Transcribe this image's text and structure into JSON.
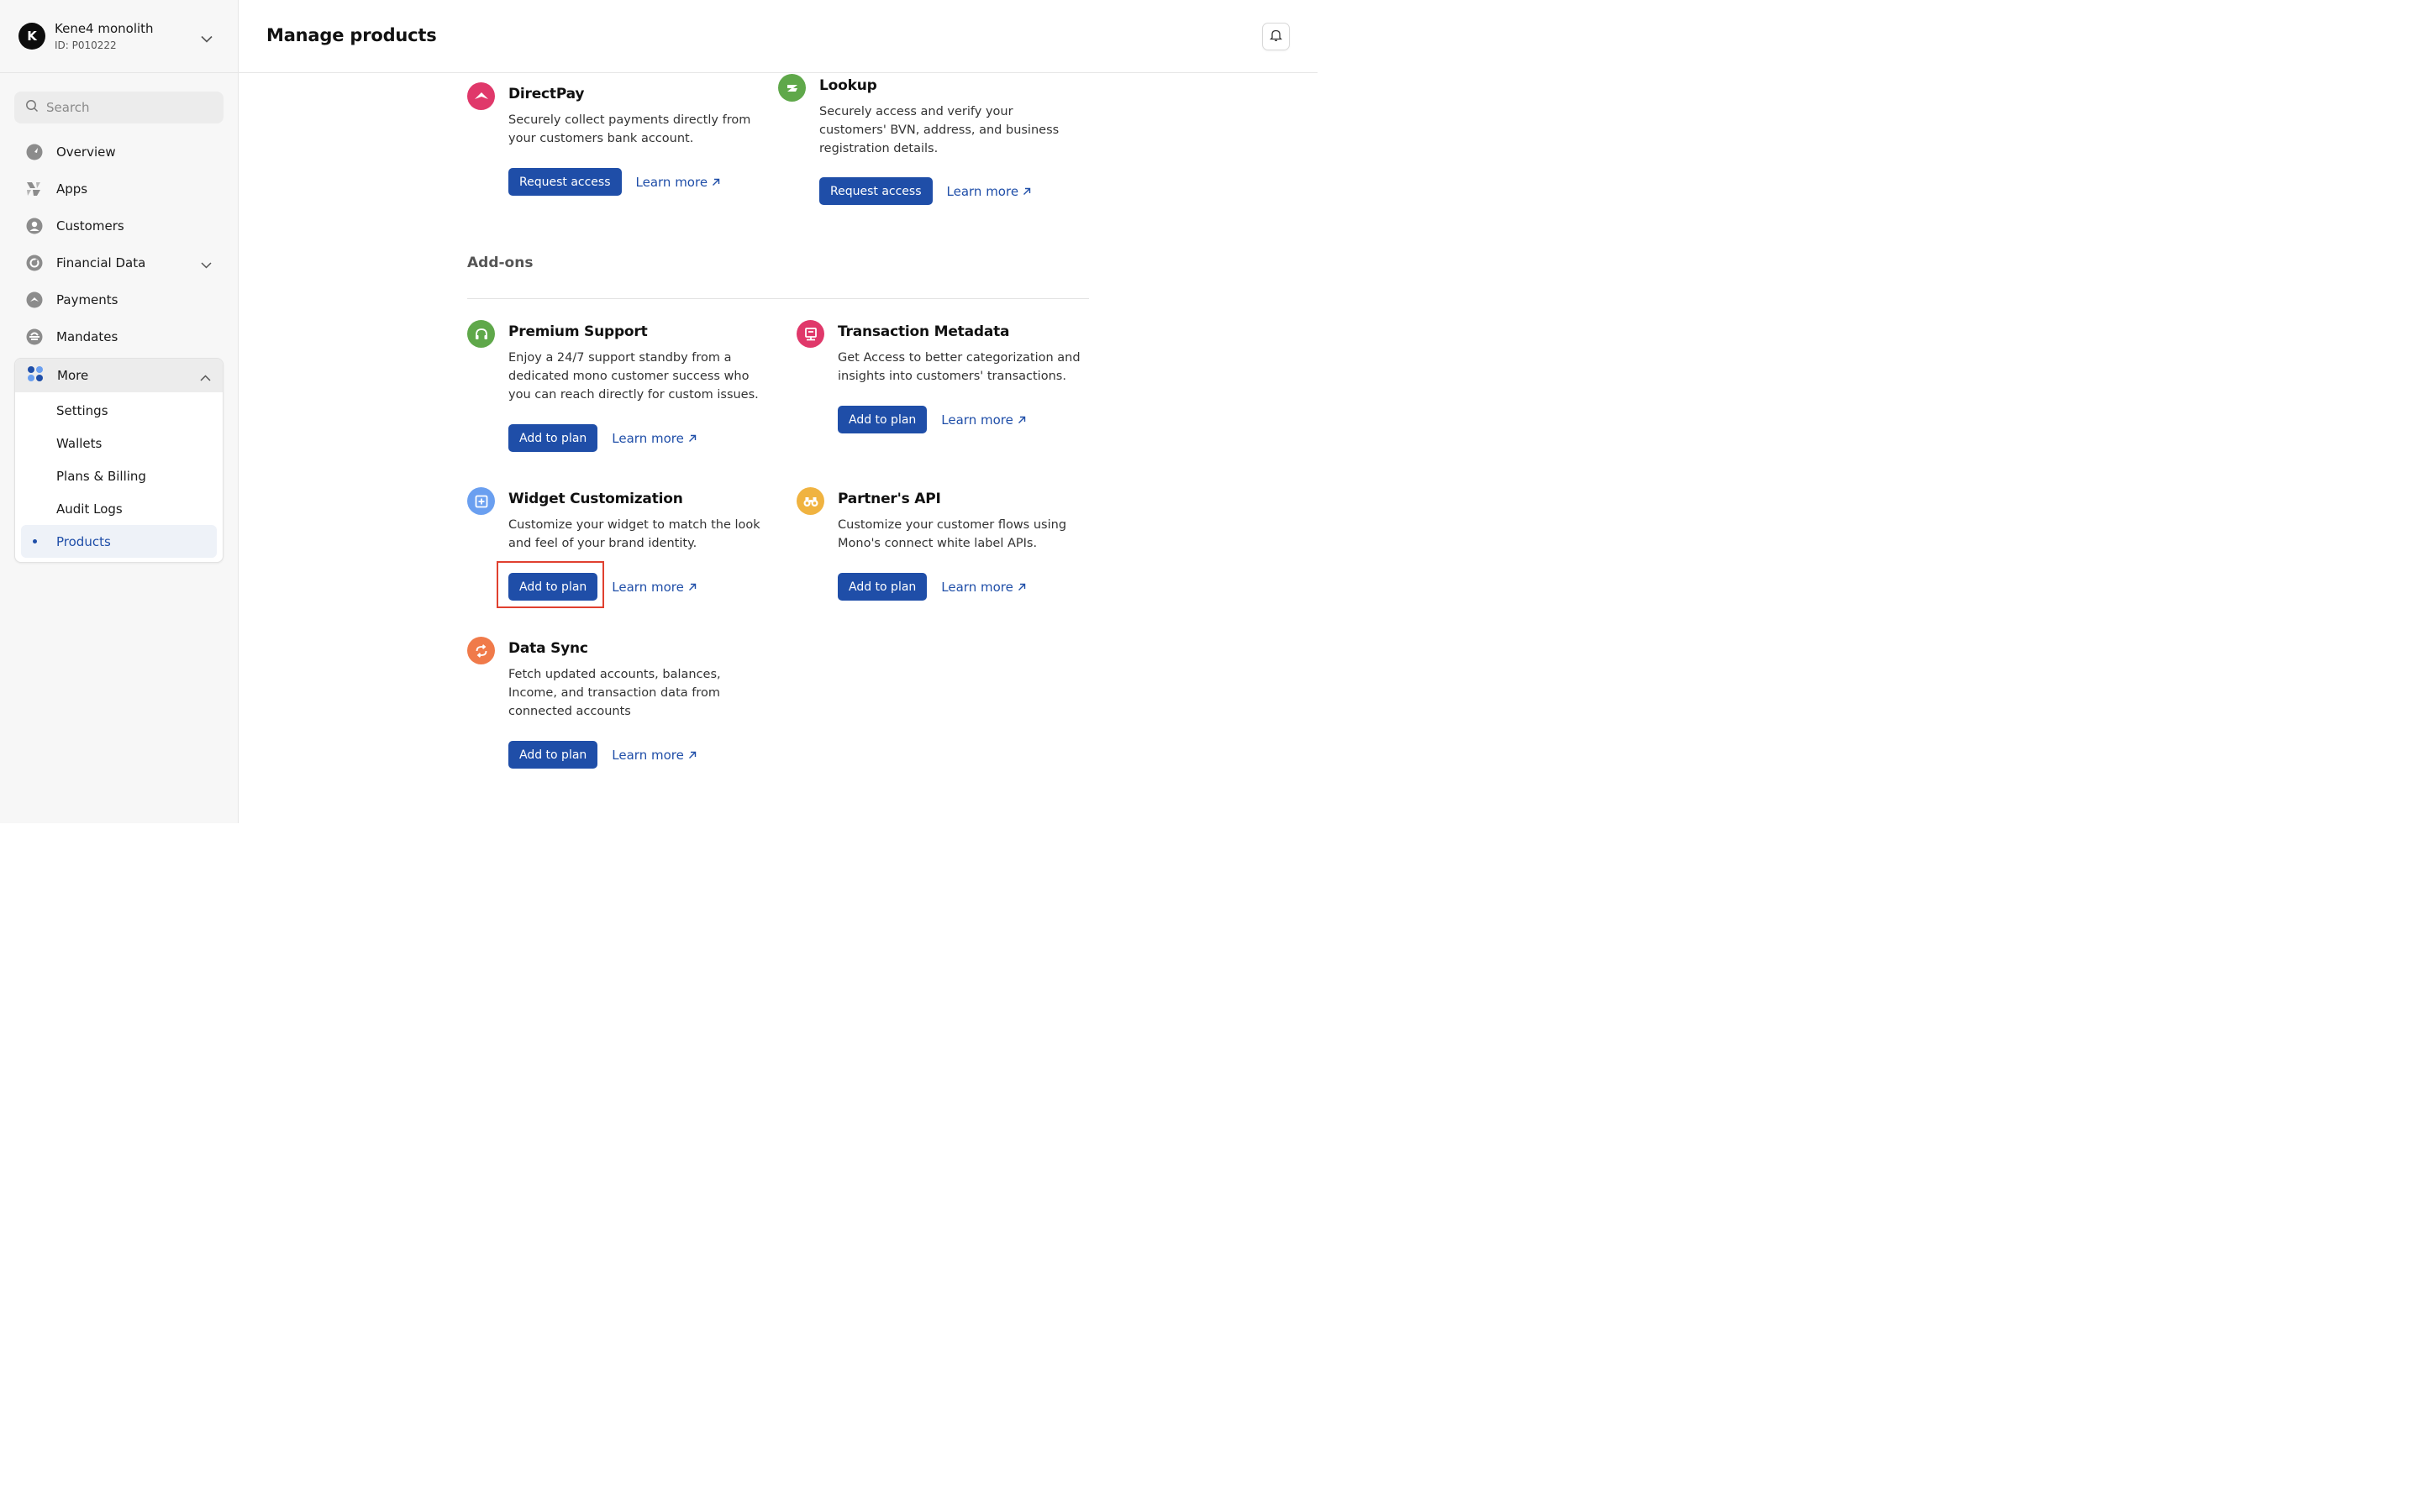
{
  "workspace": {
    "initial": "K",
    "name": "Kene4 monolith",
    "id": "ID: P010222"
  },
  "search": {
    "placeholder": "Search"
  },
  "nav": {
    "items": [
      {
        "label": "Overview"
      },
      {
        "label": "Apps"
      },
      {
        "label": "Customers"
      },
      {
        "label": "Financial Data"
      },
      {
        "label": "Payments"
      },
      {
        "label": "Mandates"
      }
    ],
    "more": {
      "label": "More",
      "items": [
        {
          "label": "Settings"
        },
        {
          "label": "Wallets"
        },
        {
          "label": "Plans & Billing"
        },
        {
          "label": "Audit Logs"
        },
        {
          "label": "Products"
        }
      ]
    }
  },
  "header": {
    "title": "Manage products"
  },
  "products": {
    "directpay": {
      "title": "DirectPay",
      "desc": "Securely collect payments directly from your customers bank account.",
      "button": "Request access",
      "link": "Learn more",
      "color": "#e0386a"
    },
    "lookup": {
      "title": "Lookup",
      "desc": "Securely access and verify your customers' BVN, address, and business registration details.",
      "button": "Request access",
      "link": "Learn more",
      "color": "#5fa84a"
    }
  },
  "addons": {
    "title": "Add-ons",
    "premium_support": {
      "title": "Premium Support",
      "desc": "Enjoy a 24/7 support standby from a dedicated mono customer success who you can reach directly for custom issues.",
      "button": "Add to plan",
      "link": "Learn more",
      "color": "#5fa84a"
    },
    "transaction_metadata": {
      "title": "Transaction Metadata",
      "desc": "Get Access to better categorization and insights into customers' transactions.",
      "button": "Add to plan",
      "link": "Learn more",
      "color": "#e0386a"
    },
    "widget_customization": {
      "title": "Widget Customization",
      "desc": "Customize your widget to match the look and feel of your brand identity.",
      "button": "Add to plan",
      "link": "Learn more",
      "color": "#6a9ff0"
    },
    "partners_api": {
      "title": "Partner's API",
      "desc": "Customize your customer flows using Mono's connect white label APIs.",
      "button": "Add to plan",
      "link": "Learn more",
      "color": "#f0b340"
    },
    "data_sync": {
      "title": "Data Sync",
      "desc": "Fetch updated accounts, balances, Income, and transaction data from connected accounts",
      "button": "Add to plan",
      "link": "Learn more",
      "color": "#f07a4a"
    }
  },
  "colors": {
    "accent": "#1f4ea8",
    "highlight": "#e0402f"
  }
}
